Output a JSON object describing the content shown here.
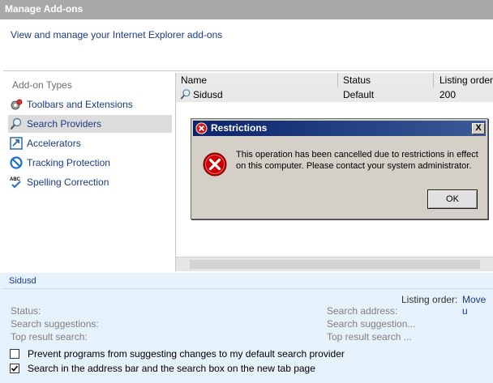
{
  "window": {
    "title": "Manage Add-ons"
  },
  "header": {
    "description": "View and manage your Internet Explorer add-ons"
  },
  "sidebar": {
    "heading": "Add-on Types",
    "items": [
      {
        "label": "Toolbars and Extensions",
        "icon": "gear-icon"
      },
      {
        "label": "Search Providers",
        "icon": "magnifier-icon",
        "selected": true
      },
      {
        "label": "Accelerators",
        "icon": "accelerator-icon"
      },
      {
        "label": "Tracking Protection",
        "icon": "no-entry-icon"
      },
      {
        "label": "Spelling Correction",
        "icon": "abc-check-icon"
      }
    ]
  },
  "list": {
    "columns": [
      "Name",
      "Status",
      "Listing order"
    ],
    "rows": [
      {
        "name": "Sidusd",
        "status": "Default",
        "order": "200"
      }
    ]
  },
  "details": {
    "name": "Sidusd",
    "listing_order_label": "Listing order:",
    "listing_order_link": "Move u",
    "left_labels": [
      "Status:",
      "Search suggestions:",
      "Top result search:"
    ],
    "right_labels": [
      "Search address:",
      "Search suggestion...",
      "Top result search ..."
    ],
    "options": [
      {
        "label": "Prevent programs from suggesting changes to my default search provider",
        "checked": false
      },
      {
        "label": "Search in the address bar and the search box on the new tab page",
        "checked": true
      }
    ]
  },
  "dialog": {
    "title": "Restrictions",
    "message": "This operation has been cancelled due to restrictions in effect on this computer. Please contact your system administrator.",
    "ok_label": "OK",
    "close_label": "X"
  }
}
